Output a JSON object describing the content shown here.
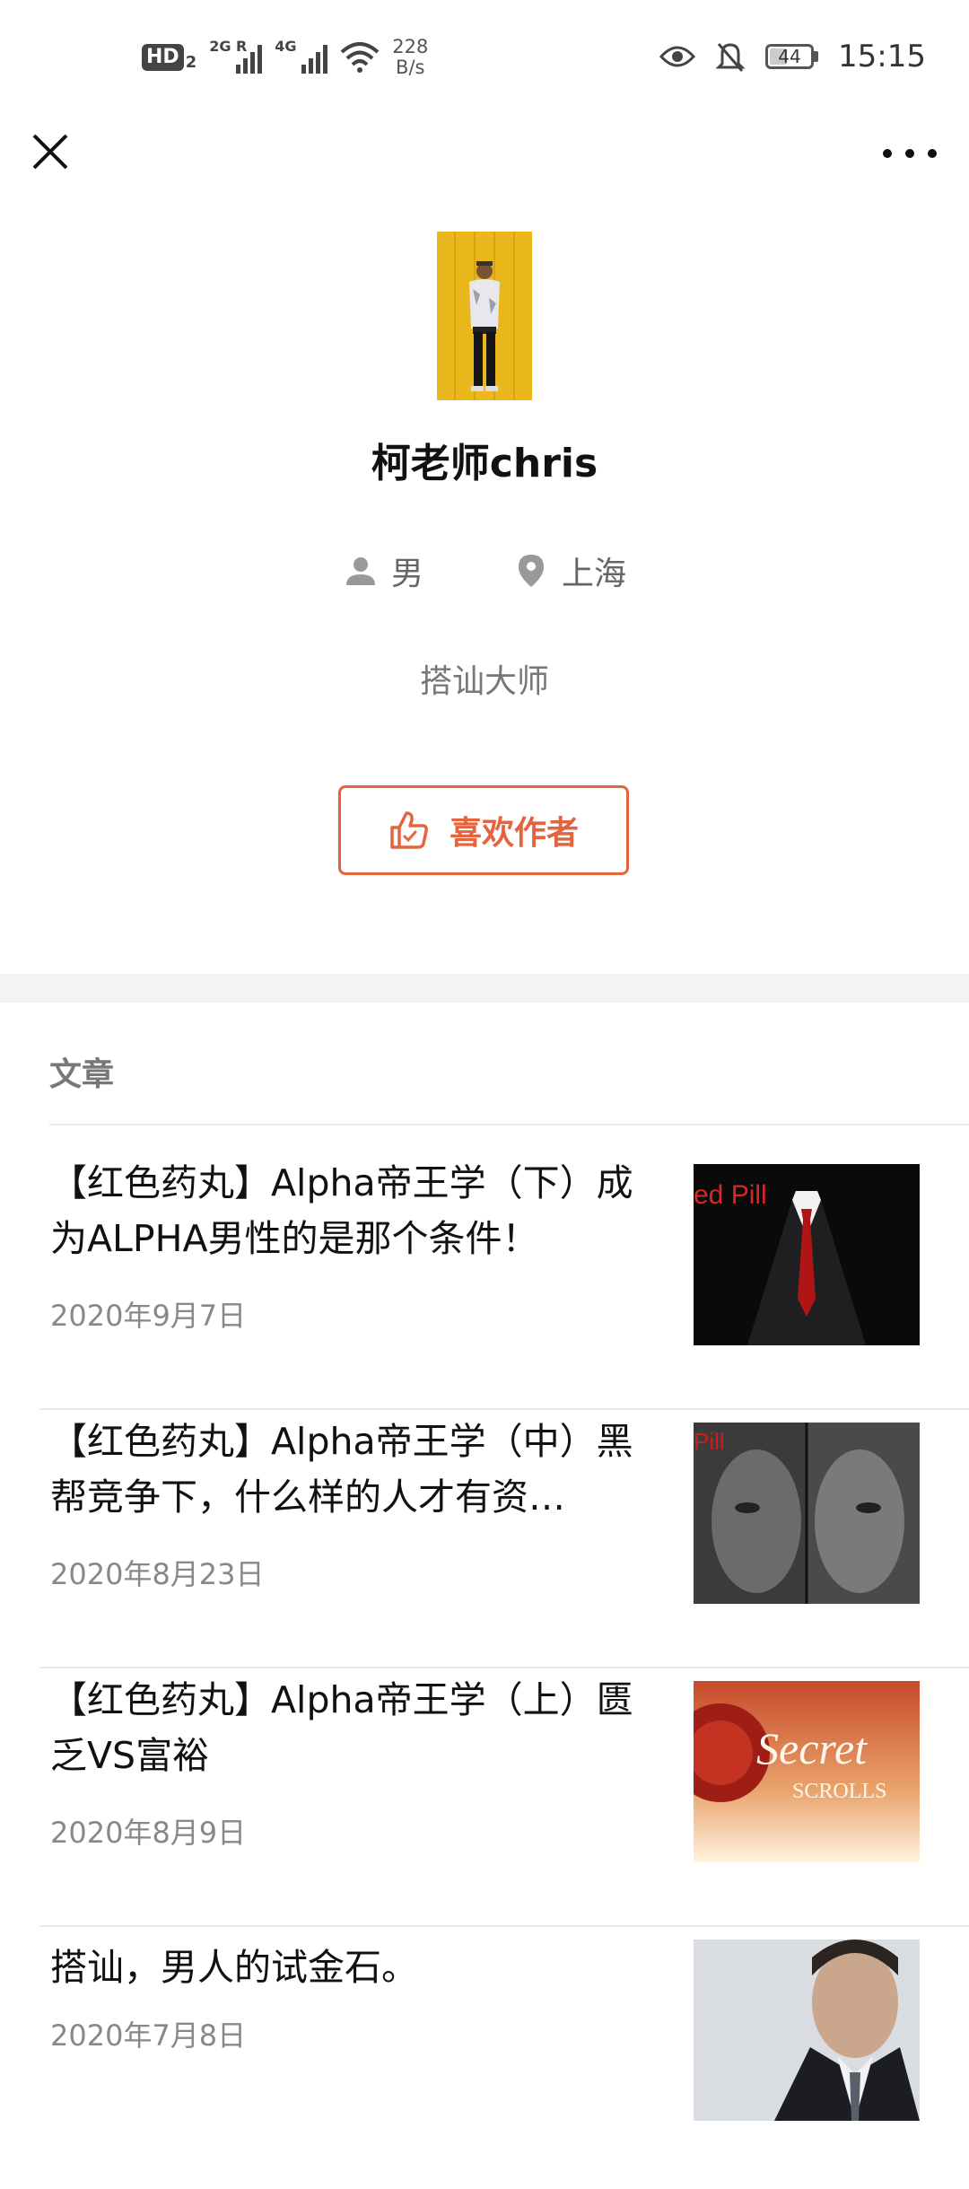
{
  "status_bar": {
    "network_badge": "HD",
    "network_badge_sub": "2",
    "signal1_label": "2G R",
    "signal2_label": "4G",
    "speed_value": "228",
    "speed_unit": "B/s",
    "battery": "44",
    "time": "15:15"
  },
  "profile": {
    "name": "柯老师chris",
    "gender": "男",
    "location": "上海",
    "signature": "搭讪大师",
    "like_button": "喜欢作者"
  },
  "section": {
    "title": "文章"
  },
  "articles": [
    {
      "title": "【红色药丸】Alpha帝王学（下）成为ALPHA男性的是那个条件！",
      "date": "2020年9月7日",
      "thumb_caption": "ed Pill"
    },
    {
      "title": "【红色药丸】Alpha帝王学（中）黑帮竞争下，什么样的人才有资…",
      "date": "2020年8月23日",
      "thumb_caption": "Pill"
    },
    {
      "title": "【红色药丸】Alpha帝王学（上）匮乏VS富裕",
      "date": "2020年8月9日",
      "thumb_caption": "SCROLLS"
    },
    {
      "title": "搭讪，男人的试金石。",
      "date": "2020年7月8日",
      "thumb_caption": ""
    }
  ],
  "colors": {
    "accent": "#e4643f",
    "text_primary": "#111111",
    "text_secondary": "#888888"
  }
}
